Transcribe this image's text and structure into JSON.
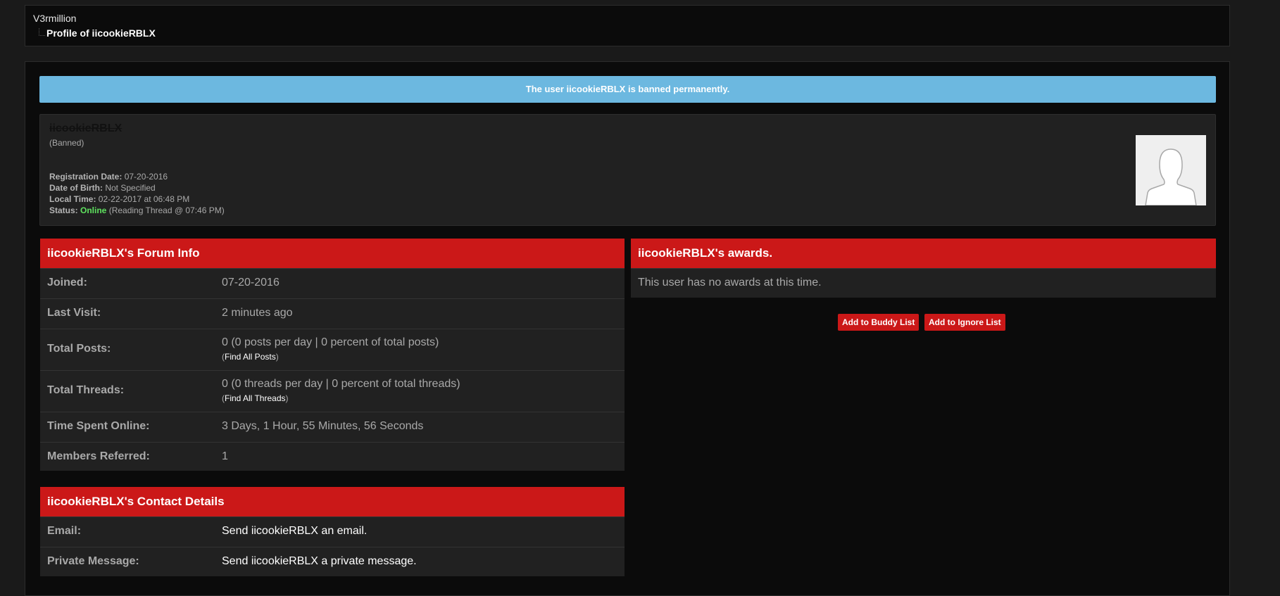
{
  "breadcrumb": {
    "site": "V3rmillion",
    "page": "Profile of iicookieRBLX"
  },
  "banner": {
    "text": "The user iicookieRBLX is banned permanently.",
    "color": "#6cb8e0"
  },
  "profile": {
    "username": "iicookieRBLX",
    "usergroup": "(Banned)",
    "avatar_icon": "default-avatar-silhouette",
    "details": [
      {
        "label": "Registration Date:",
        "value": " 07-20-2016"
      },
      {
        "label": "Date of Birth:",
        "value": " Not Specified"
      },
      {
        "label": "Local Time:",
        "value": " 02-22-2017 at 06:48 PM"
      }
    ],
    "status": {
      "label": "Status:",
      "state": "Online",
      "activity": " (Reading Thread @ 07:46 PM)",
      "state_color": "#5fe35f"
    }
  },
  "forum_info": {
    "title": "iicookieRBLX's Forum Info",
    "rows": [
      {
        "label": "Joined:",
        "value": "07-20-2016"
      },
      {
        "label": "Last Visit:",
        "value": "2 minutes ago"
      },
      {
        "label": "Total Posts:",
        "value": "0 (0 posts per day | 0 percent of total posts)",
        "link_prefix": "(",
        "link": "Find All Posts",
        "link_suffix": ")"
      },
      {
        "label": "Total Threads:",
        "value": "0 (0 threads per day | 0 percent of total threads)",
        "link_prefix": "(",
        "link": "Find All Threads",
        "link_suffix": ")"
      },
      {
        "label": "Time Spent Online:",
        "value": "3 Days, 1 Hour, 55 Minutes, 56 Seconds"
      },
      {
        "label": "Members Referred:",
        "value": "1"
      }
    ]
  },
  "contact": {
    "title": "iicookieRBLX's Contact Details",
    "rows": [
      {
        "label": "Email:",
        "value": "Send iicookieRBLX an email."
      },
      {
        "label": "Private Message:",
        "value": "Send iicookieRBLX a private message."
      }
    ]
  },
  "awards": {
    "title": "iicookieRBLX's awards.",
    "empty_text": "This user has no awards at this time."
  },
  "actions": {
    "buddy": "Add to Buddy List",
    "ignore": "Add to Ignore List"
  },
  "colors": {
    "header_red": "#cb1818",
    "background": "#0b0b0b",
    "panel": "#212121"
  }
}
